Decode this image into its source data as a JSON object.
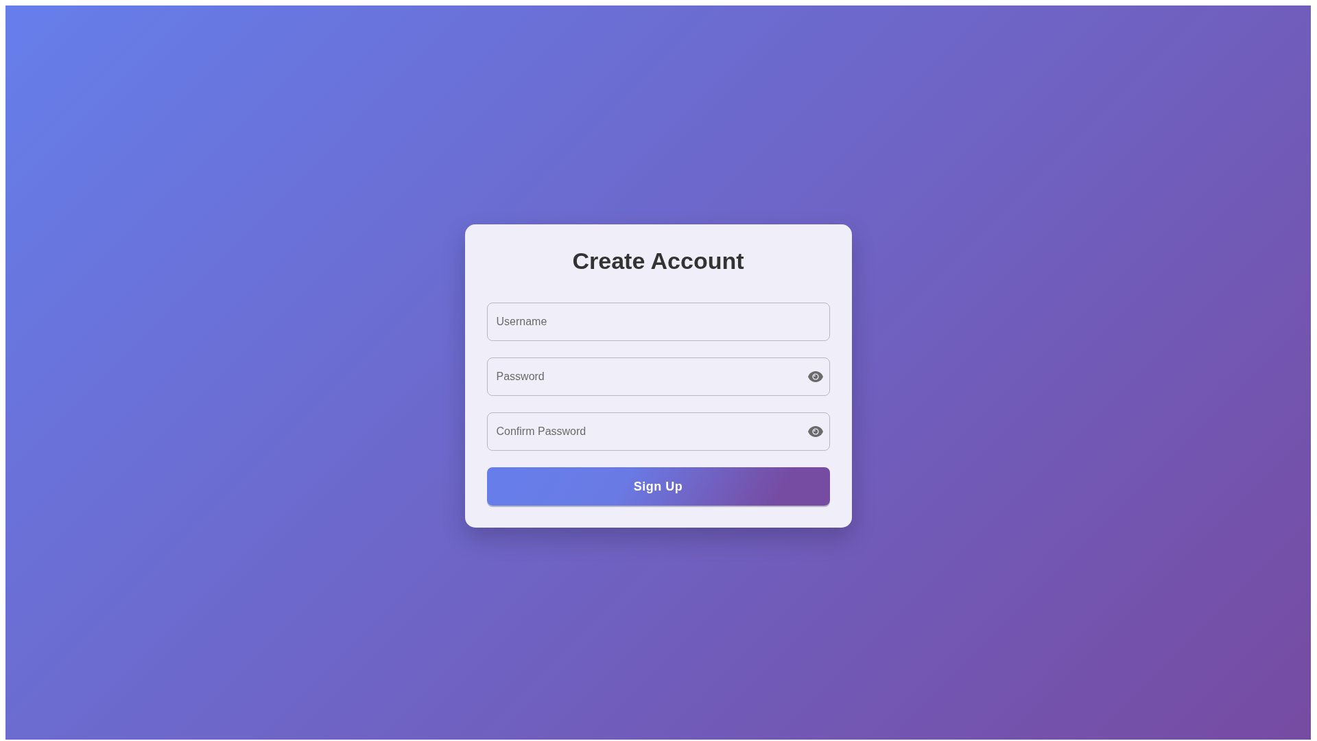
{
  "title": "Create Account",
  "fields": [
    {
      "placeholder": "Username",
      "kind": "text"
    },
    {
      "placeholder": "Password",
      "kind": "password"
    },
    {
      "placeholder": "Confirm Password",
      "kind": "password"
    }
  ],
  "button": "Sign Up"
}
